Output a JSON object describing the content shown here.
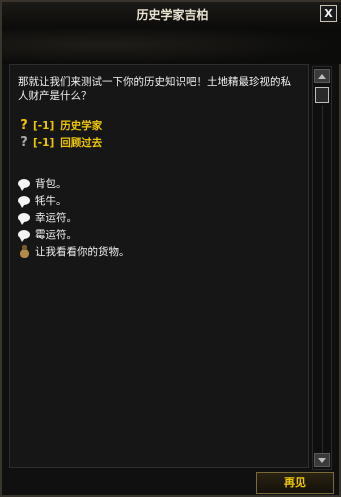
{
  "window": {
    "title": "历史学家吉柏",
    "close_label": "X"
  },
  "dialog": {
    "question": "那就让我们来测试一下你的历史知识吧！土地精最珍视的私人财产是什么？"
  },
  "quests": [
    {
      "mark": "?",
      "level": "[-1]",
      "label": "历史学家",
      "color": "#f5c400"
    },
    {
      "mark": "?",
      "level": "[-1]",
      "label": "回顾过去",
      "color": "#aaaaaa"
    }
  ],
  "options": [
    {
      "icon": "speech-bubble-icon",
      "label": "背包。"
    },
    {
      "icon": "speech-bubble-icon",
      "label": "牦牛。"
    },
    {
      "icon": "speech-bubble-icon",
      "label": "幸运符。"
    },
    {
      "icon": "speech-bubble-icon",
      "label": "霉运符。"
    },
    {
      "icon": "money-bag-icon",
      "label": "让我看看你的货物。"
    }
  ],
  "footer": {
    "goodbye_label": "再见"
  },
  "colors": {
    "quest_text": "#f0c800",
    "dialog_text": "#f2f2f2",
    "background": "#161616"
  }
}
